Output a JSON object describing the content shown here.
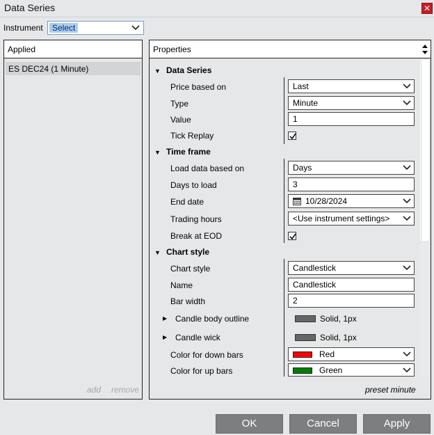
{
  "window": {
    "title": "Data Series",
    "close_icon": "close-icon"
  },
  "instrument": {
    "label": "Instrument",
    "selected": "Select"
  },
  "applied": {
    "header": "Applied",
    "items": [
      "ES DEC24 (1 Minute)"
    ],
    "add_label": "add",
    "remove_label": "remove"
  },
  "properties": {
    "header": "Properties",
    "sections": {
      "data_series": {
        "title": "Data Series",
        "price_based_on": {
          "label": "Price based on",
          "value": "Last"
        },
        "type": {
          "label": "Type",
          "value": "Minute"
        },
        "value": {
          "label": "Value",
          "value": "1"
        },
        "tick_replay": {
          "label": "Tick Replay",
          "checked": true
        }
      },
      "time_frame": {
        "title": "Time frame",
        "load_data_based_on": {
          "label": "Load data based on",
          "value": "Days"
        },
        "days_to_load": {
          "label": "Days to load",
          "value": "3"
        },
        "end_date": {
          "label": "End date",
          "value": "10/28/2024"
        },
        "trading_hours": {
          "label": "Trading hours",
          "value": "<Use instrument settings>"
        },
        "break_at_eod": {
          "label": "Break at EOD",
          "checked": true
        }
      },
      "chart_style": {
        "title": "Chart style",
        "chart_style": {
          "label": "Chart style",
          "value": "Candlestick"
        },
        "name": {
          "label": "Name",
          "value": "Candlestick"
        },
        "bar_width": {
          "label": "Bar width",
          "value": "2"
        },
        "candle_body_outline": {
          "label": "Candle body outline",
          "value": "Solid, 1px"
        },
        "candle_wick": {
          "label": "Candle wick",
          "value": "Solid, 1px"
        },
        "color_down": {
          "label": "Color for down bars",
          "value": "Red",
          "color": "#ff0000"
        },
        "color_up": {
          "label": "Color for up bars",
          "value": "Green",
          "color": "#008000"
        }
      }
    },
    "preset_label": "preset minute"
  },
  "buttons": {
    "ok": "OK",
    "cancel": "Cancel",
    "apply": "Apply"
  }
}
